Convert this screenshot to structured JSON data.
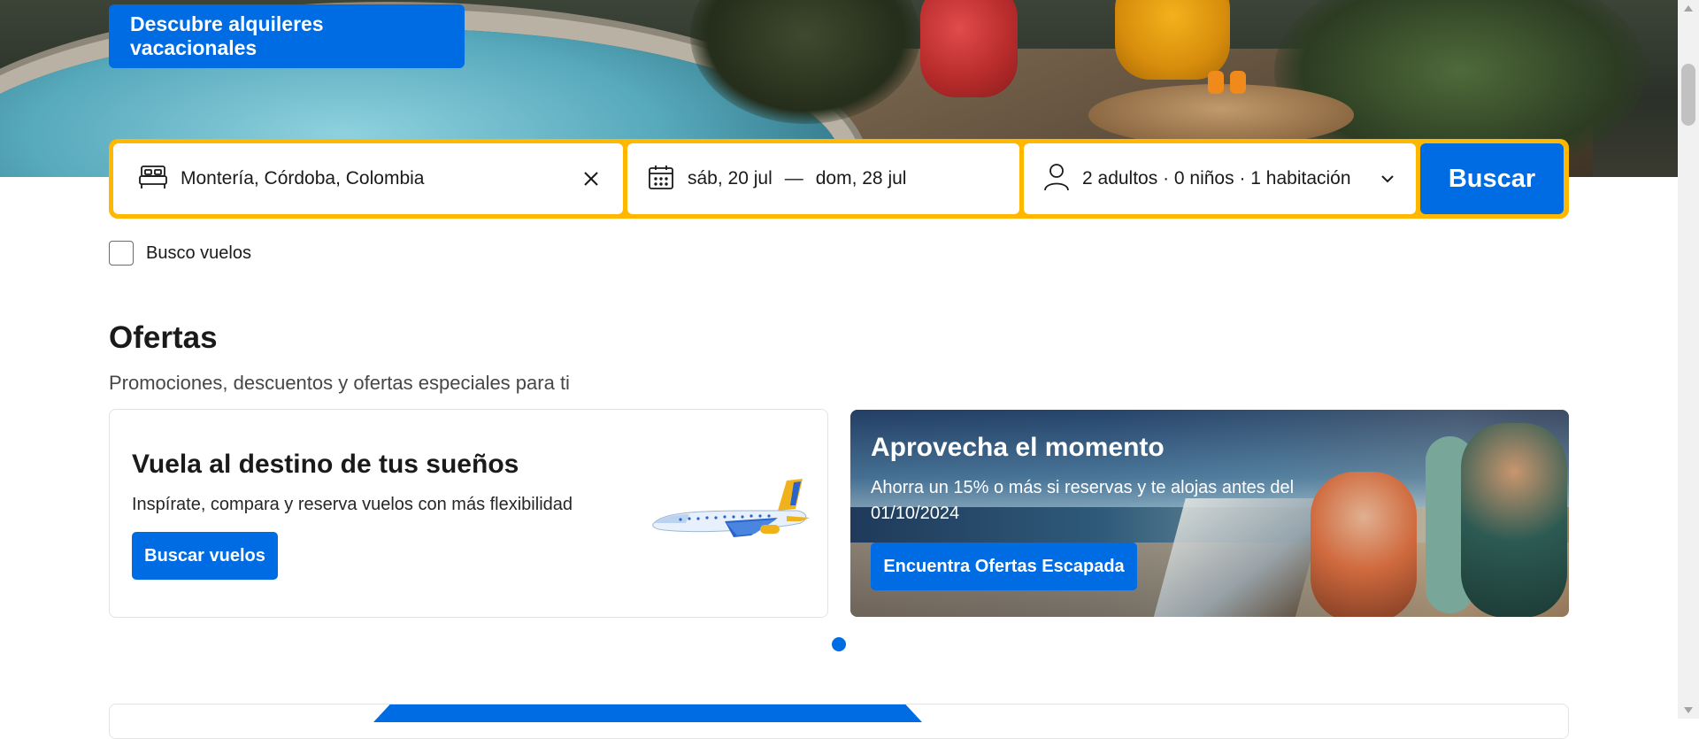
{
  "hero": {
    "cta_label": "Descubre alquileres vacacionales"
  },
  "search": {
    "destination": "Montería, Córdoba, Colombia",
    "checkin": "sáb, 20 jul",
    "date_separator": "—",
    "checkout": "dom, 28 jul",
    "occupancy": "2 adultos · 0 niños · 1 habitación",
    "button_label": "Buscar",
    "icons": [
      "bed-icon",
      "calendar-icon",
      "person-icon",
      "close-icon",
      "chevron-down-icon"
    ]
  },
  "flights_checkbox": {
    "label": "Busco vuelos",
    "checked": false
  },
  "offers": {
    "title": "Ofertas",
    "subtitle": "Promociones, descuentos y ofertas especiales para ti",
    "cards": [
      {
        "title": "Vuela al destino de tus sueños",
        "subtitle": "Inspírate, compara y reserva vuelos con más flexibilidad",
        "button_label": "Buscar vuelos"
      },
      {
        "title": "Aprovecha el momento",
        "subtitle": "Ahorra un 15% o más si reservas y te alojas antes del 01/10/2024",
        "button_label": "Encuentra Ofertas Escapada"
      }
    ],
    "active_slide": 1,
    "slide_count": 1
  },
  "colors": {
    "brand_blue": "#006ce4",
    "search_border": "#ffb700",
    "text_primary": "#1a1a1a",
    "text_secondary": "#474747"
  }
}
